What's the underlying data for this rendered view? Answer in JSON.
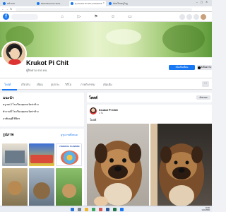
{
  "browser": {
    "tabs": [
      {
        "label": "หน้าแรก"
      },
      {
        "label": "Meta Business Suite"
      },
      {
        "label": "(1) Krukot Pi Chit | Facebook"
      },
      {
        "label": "ห้องเรียนครูโกฏ"
      }
    ]
  },
  "profile": {
    "name": "Krukot Pi Chit",
    "followers": "ผู้ติดตาม 930 คน",
    "primary_button": "เพิ่มเป็นเพื่อน",
    "secondary_button": "ส่งข้อความ"
  },
  "tabs": [
    "โพสต์",
    "เกี่ยวกับ",
    "เพื่อน",
    "รูปภาพ",
    "วิดีโอ",
    "ภาพกิจกรรม",
    "เพิ่มเติม"
  ],
  "intro": {
    "title": "แนะนำ",
    "lines": [
      "ครู คศ.3 โรงเรียนชุมชนวัดท่าช้าง",
      "ทำงานที่ โรงเรียนชุมชนวัดท่าช้าง",
      "อาศัยอยู่ที่ พิจิตร"
    ]
  },
  "photos": {
    "title": "รูปภาพ",
    "see_all": "ดูรูปภาพทั้งหมด",
    "planning_label": "FINANCIAL PLANNING"
  },
  "posts_header": {
    "title": "โพสต์",
    "filter": "ตัวกรอง"
  },
  "post": {
    "author": "Krukot Pi Chit",
    "time": "4 วัน",
    "text": "โพสต์"
  },
  "taskbar": {
    "time": "10:30",
    "date": "12/4/2566"
  }
}
